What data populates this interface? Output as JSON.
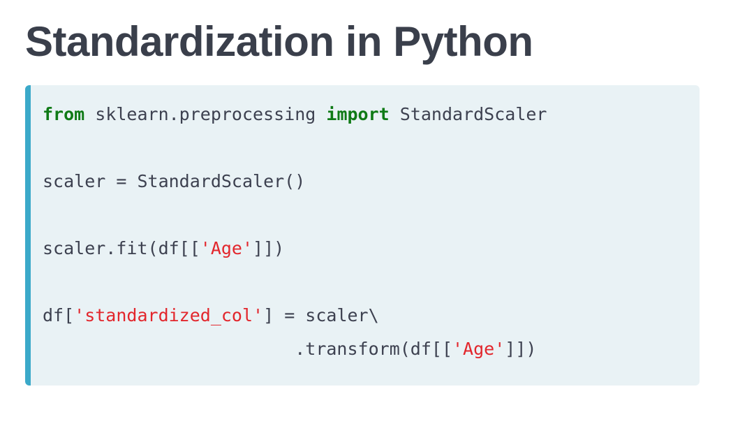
{
  "title": "Standardization in Python",
  "code": {
    "line1": {
      "kw_from": "from",
      "module": " sklearn.preprocessing ",
      "kw_import": "import",
      "name": " StandardScaler"
    },
    "line2": "scaler = StandardScaler()",
    "line3": {
      "before": "scaler.fit(df[[",
      "string": "'Age'",
      "after": "]])"
    },
    "line4": {
      "before": "df[",
      "string": "'standardized_col'",
      "after": "] = scaler\\"
    },
    "line5": {
      "before": "                        .transform(df[[",
      "string": "'Age'",
      "after": "]])"
    }
  },
  "colors": {
    "title": "#3a3f4b",
    "code_background": "#e9f2f5",
    "accent_bar": "#3ba9c9",
    "keyword": "#0f7a16",
    "string": "#e2262c",
    "code_text": "#3d4150"
  }
}
